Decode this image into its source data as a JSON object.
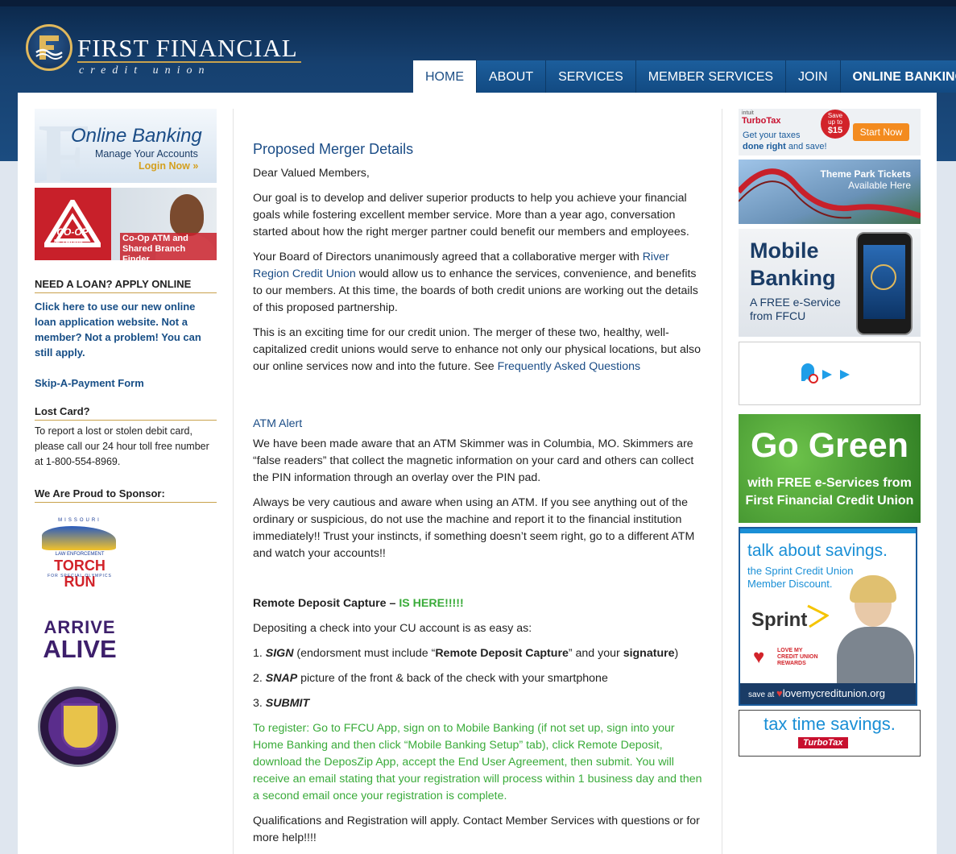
{
  "brand": {
    "title": "FIRST FINANCIAL",
    "subtitle": "credit union",
    "colors": {
      "navy": "#16406f",
      "link": "#1a4c86",
      "gold": "#c9a24d",
      "green": "#3aab3a"
    }
  },
  "nav": [
    {
      "label": "HOME",
      "active": true
    },
    {
      "label": "ABOUT"
    },
    {
      "label": "SERVICES"
    },
    {
      "label": "MEMBER SERVICES"
    },
    {
      "label": "JOIN"
    },
    {
      "label": "ONLINE BANKING"
    }
  ],
  "left": {
    "online_banking": {
      "title": "Online Banking",
      "sub": "Manage Your Accounts",
      "cta": "Login Now »"
    },
    "coop": {
      "brand": "CO-OP",
      "network": "NETWORK",
      "caption_1": "Co-Op ATM and",
      "caption_2": "Shared Branch Finder"
    },
    "loan": {
      "heading": "NEED A LOAN? APPLY ONLINE",
      "link": "Click here to use our new online loan application website. Not a member? Not a problem! You can still apply."
    },
    "skip_payment": "Skip-A-Payment Form",
    "lost_card": {
      "heading": "Lost Card?",
      "text": "To report a lost or stolen debit card, please call our 24 hour toll free number at 1-800-554-8969."
    },
    "sponsor": {
      "heading": "We Are Proud to Sponsor:",
      "torch_top": "MISSOURI",
      "torch_mid": "LAW ENFORCEMENT",
      "torch_main": "TORCH RUN",
      "torch_bottom": "FOR SPECIAL OLYMPICS",
      "arrive_1": "ARRIVE",
      "arrive_2": "ALIVE"
    }
  },
  "main": {
    "title": "Proposed Merger Details",
    "greeting": "Dear Valued Members,",
    "p1": "Our goal is to develop and deliver superior products to help you achieve your financial goals while fostering excellent member service. More than a year ago, conversation started about how the right merger partner could benefit our members and employees.",
    "p2_a": "Your Board of Directors unanimously agreed that a collaborative merger with ",
    "p2_link": "River Region Credit Union",
    "p2_b": " would allow us to enhance the services, convenience, and benefits to our members. At this time, the boards of both credit unions are working out the details of this proposed partnership.",
    "p3_a": "This is an exciting time for our credit union. The merger of these two, healthy, well-capitalized credit unions would serve to enhance not only our physical locations, but also our online services now and into the future.  See ",
    "p3_link": "Frequently Asked Questions",
    "atm_title": "ATM Alert",
    "atm_p1": "We have been made aware that an ATM Skimmer was in Columbia, MO. Skimmers are “false readers” that collect the magnetic information on your card and others can collect the PIN information through an overlay over the PIN pad.",
    "atm_p2": "Always be very cautious and aware when using an ATM. If you see anything out of the ordinary or suspicious, do not use the machine and report it to the financial institution immediately!! Trust your instincts, if something doesn’t seem right, go to a different ATM and watch your accounts!!",
    "rdc_title": "Remote Deposit Capture – ",
    "rdc_here": "IS HERE!!!!!",
    "rdc_intro": "Depositing a check into your CU account is as easy as:",
    "step1_num": "1. ",
    "step1_key": "SIGN",
    "step1_a": " (endorsment must include “",
    "step1_b": "Remote Deposit Capture",
    "step1_c": "” and your ",
    "step1_d": "signature",
    "step1_e": ")",
    "step2_num": "2. ",
    "step2_key": "SNAP",
    "step2_a": " picture of the front & back of the check with your smartphone",
    "step3_num": "3. ",
    "step3_key": "SUBMIT",
    "register": "To register: Go to FFCU App, sign on to Mobile Banking (if not set up, sign into your Home Banking and then click “Mobile Banking Setup” tab), click Remote Deposit, download the DeposZip App, accept the End User Agreement, then submit. You will receive an email stating that your registration will process within 1 business day and then a second email once your registration is complete.",
    "qual_a": "Qualifications and Registration will apply. ",
    "qual_b": "Contact Member Services with questions or for more help!!!!"
  },
  "right": {
    "turbotax": {
      "intuit": "intuit",
      "brand": "TurboTax",
      "line1": "Get your taxes",
      "line2a": "done right",
      "line2b": " and save!",
      "badge_1": "Save",
      "badge_2": "up to",
      "badge_3": "$15",
      "cta": "Start Now"
    },
    "theme_park": {
      "line1": "Theme Park Tickets",
      "line2": "Available Here"
    },
    "mobile": {
      "title_1": "Mobile",
      "title_2": "Banking",
      "sub_1": "A FREE e-Service",
      "sub_2": "from FFCU"
    },
    "go_green": {
      "title": "Go Green",
      "sub_1": "with FREE e-Services from",
      "sub_2": "First Financial Credit Union"
    },
    "sprint": {
      "headline": "talk about savings.",
      "sub_1": "the Sprint Credit Union",
      "sub_2": "Member Discount.",
      "brand": "Sprint",
      "love_1": "LOVE MY",
      "love_2": "CREDIT UNION",
      "love_3": "REWARDS",
      "footer_a": "save at ",
      "footer_b": "lovemycreditunion.org"
    },
    "tax_time": {
      "headline": "tax time savings.",
      "brand": "TurboTax"
    }
  }
}
